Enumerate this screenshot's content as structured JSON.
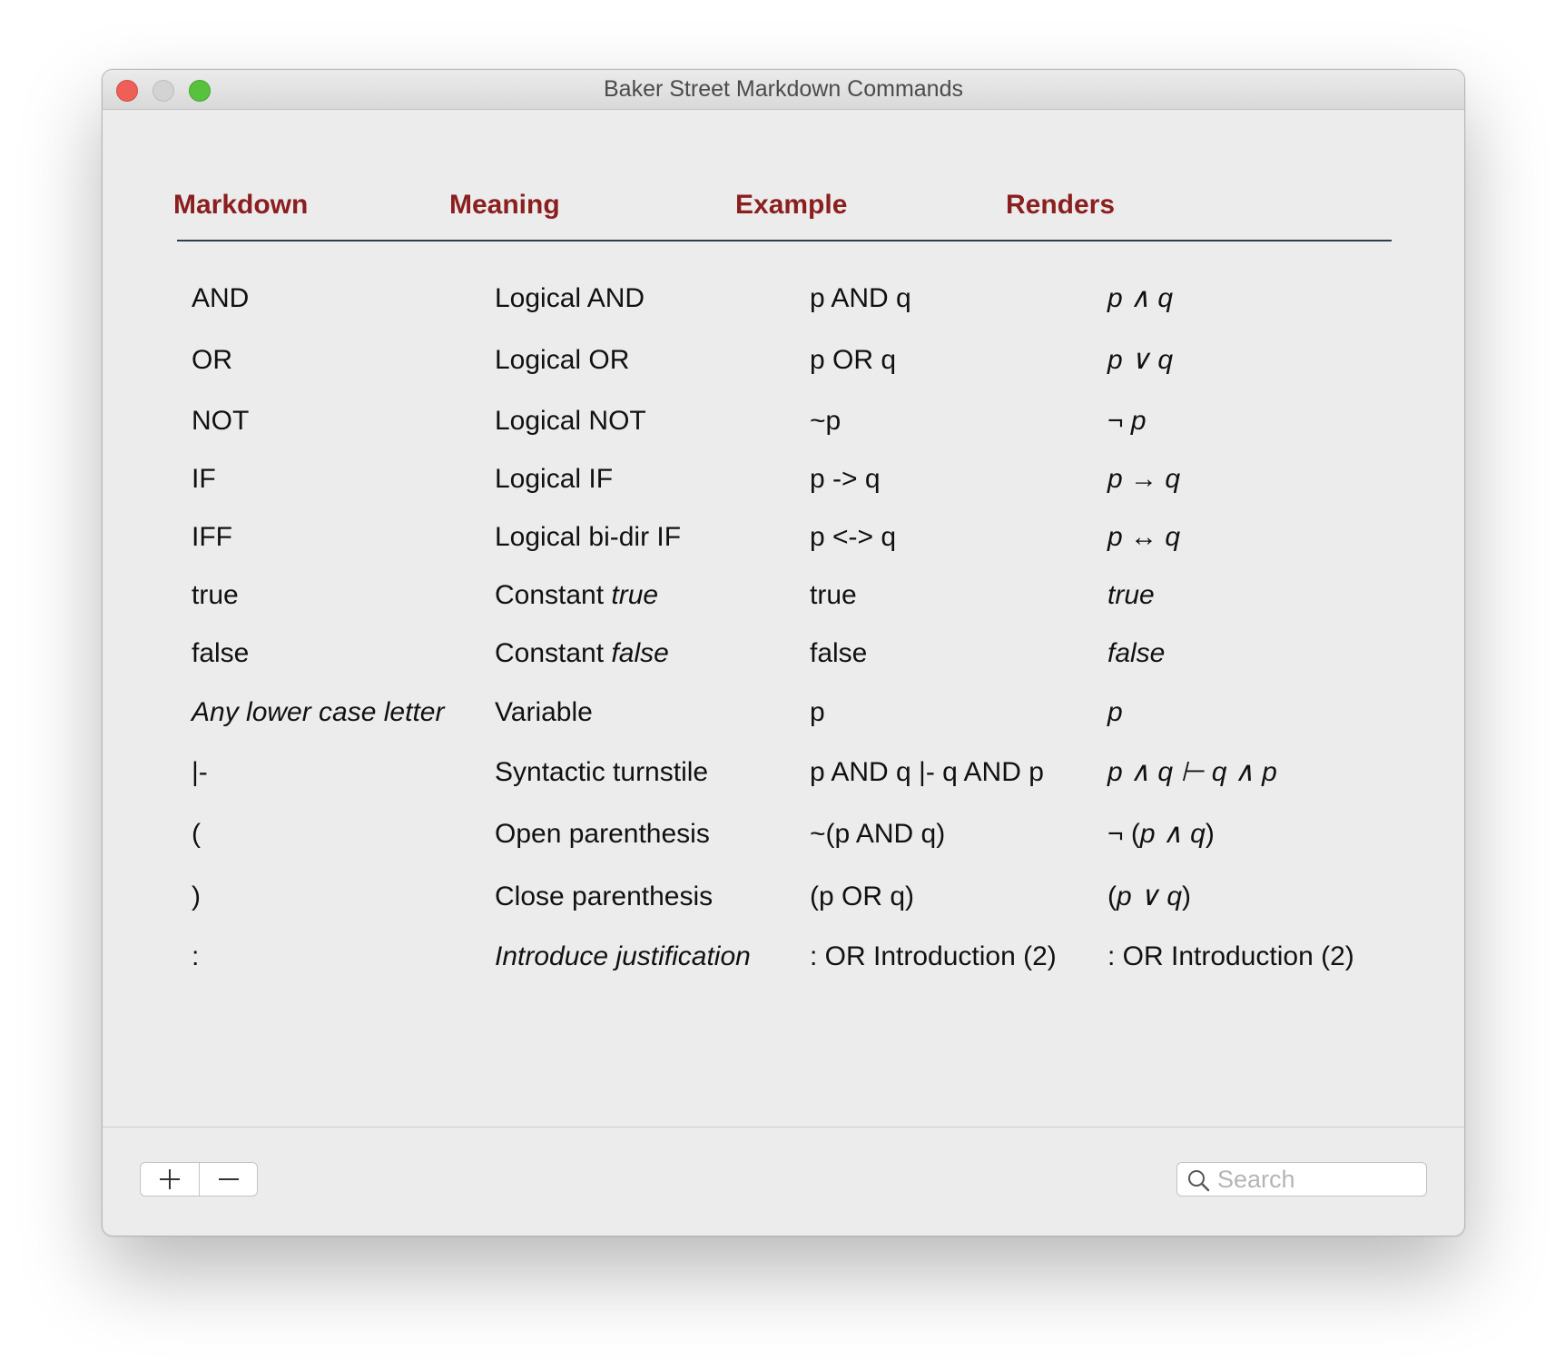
{
  "window": {
    "title": "Baker Street Markdown Commands"
  },
  "columns": {
    "markdown": "Markdown",
    "meaning": "Meaning",
    "example": "Example",
    "renders": "Renders"
  },
  "rows": [
    {
      "markdown": "AND",
      "meaning": "Logical AND",
      "example": "p AND q",
      "renders": "p ∧ q"
    },
    {
      "markdown": "OR",
      "meaning": "Logical OR",
      "example": "p OR q",
      "renders": "p ∨ q"
    },
    {
      "markdown": "NOT",
      "meaning": "Logical NOT",
      "example": "~p",
      "renders": "¬ p"
    },
    {
      "markdown": "IF",
      "meaning": "Logical IF",
      "example": "p -> q",
      "renders": "p → q"
    },
    {
      "markdown": "IFF",
      "meaning": "Logical bi-dir IF",
      "example": "p <-> q",
      "renders": "p ↔ q"
    },
    {
      "markdown": "true",
      "meaning_prefix": "Constant ",
      "meaning_em": "true",
      "example": "true",
      "renders": "true"
    },
    {
      "markdown": "false",
      "meaning_prefix": "Constant ",
      "meaning_em": "false",
      "example": "false",
      "renders": "false"
    },
    {
      "markdown": "Any lower case letter",
      "meaning": "Variable",
      "example": "p",
      "renders": "p"
    },
    {
      "markdown": "|-",
      "meaning": "Syntactic turnstile",
      "example": "p AND q |- q AND p",
      "renders": "p ∧ q ⊢ q ∧ p"
    },
    {
      "markdown": "(",
      "meaning": "Open parenthesis",
      "example": "~(p AND q)",
      "renders_prefix": "¬ (",
      "renders_em": "p ∧ q",
      "renders_suffix": ")"
    },
    {
      "markdown": ")",
      "meaning": "Close parenthesis",
      "example": "(p OR q)",
      "renders_prefix": "(",
      "renders_em": "p ∨ q",
      "renders_suffix": ")"
    },
    {
      "markdown": ":",
      "meaning": "Introduce justification",
      "example": ": OR Introduction (2)",
      "renders": ": OR Introduction (2)"
    }
  ],
  "toolbar": {
    "add_icon": "plus-icon",
    "remove_icon": "minus-icon",
    "search_placeholder": "Search",
    "search_icon": "magnifier-icon"
  },
  "colors": {
    "header_text": "#8b1e1e",
    "header_rule": "#2f3e4d",
    "close": "#ee5f58",
    "minimize": "#d3d3d3",
    "maximize": "#58c13d"
  }
}
